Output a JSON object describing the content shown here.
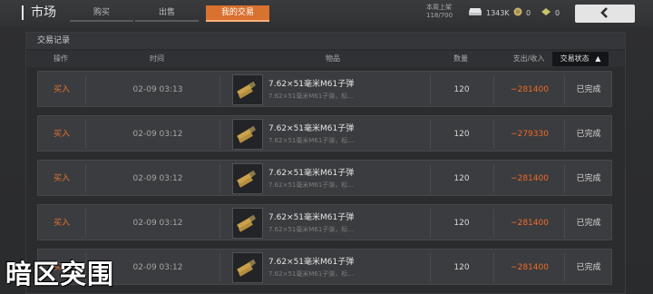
{
  "header": {
    "title": "市场",
    "tabs": [
      {
        "label": "购买",
        "active": false
      },
      {
        "label": "出售",
        "active": false
      },
      {
        "label": "我的交易",
        "active": true
      }
    ],
    "weekly_label": "本周上架",
    "weekly_value": "118/700",
    "currencies": [
      {
        "icon": "money-stack-icon",
        "value": "1343K"
      },
      {
        "icon": "gold-coin-icon",
        "value": "0"
      },
      {
        "icon": "ticket-icon",
        "value": "0"
      }
    ],
    "back_icon": "chevron-left-icon"
  },
  "panel": {
    "title": "交易记录",
    "columns": {
      "action": "操作",
      "time": "时间",
      "item": "物品",
      "quantity": "数量",
      "amount": "支出/收入",
      "status": "交易状态"
    }
  },
  "rows": [
    {
      "action": "买入",
      "time": "02-09 03:13",
      "item_name": "7.62×51毫米M61子弹",
      "item_desc": "7.62×51毫米M61子弹，标...",
      "quantity": "120",
      "amount": "−281400",
      "status": "已完成"
    },
    {
      "action": "买入",
      "time": "02-09 03:12",
      "item_name": "7.62×51毫米M61子弹",
      "item_desc": "7.62×51毫米M61子弹，标...",
      "quantity": "120",
      "amount": "−279330",
      "status": "已完成"
    },
    {
      "action": "买入",
      "time": "02-09 03:12",
      "item_name": "7.62×51毫米M61子弹",
      "item_desc": "7.62×51毫米M61子弹，标...",
      "quantity": "120",
      "amount": "−281400",
      "status": "已完成"
    },
    {
      "action": "买入",
      "time": "02-09 03:12",
      "item_name": "7.62×51毫米M61子弹",
      "item_desc": "7.62×51毫米M61子弹，标...",
      "quantity": "120",
      "amount": "−281400",
      "status": "已完成"
    },
    {
      "action": "买入",
      "time": "02-09 03:12",
      "item_name": "7.62×51毫米M61子弹",
      "item_desc": "7.62×51毫米M61子弹，标...",
      "quantity": "120",
      "amount": "−281400",
      "status": "已完成"
    }
  ],
  "watermark": "暗区突围",
  "colors": {
    "accent": "#d9712f",
    "amount_negative": "#ef6a26",
    "row_bg": "#3b3c3f"
  }
}
